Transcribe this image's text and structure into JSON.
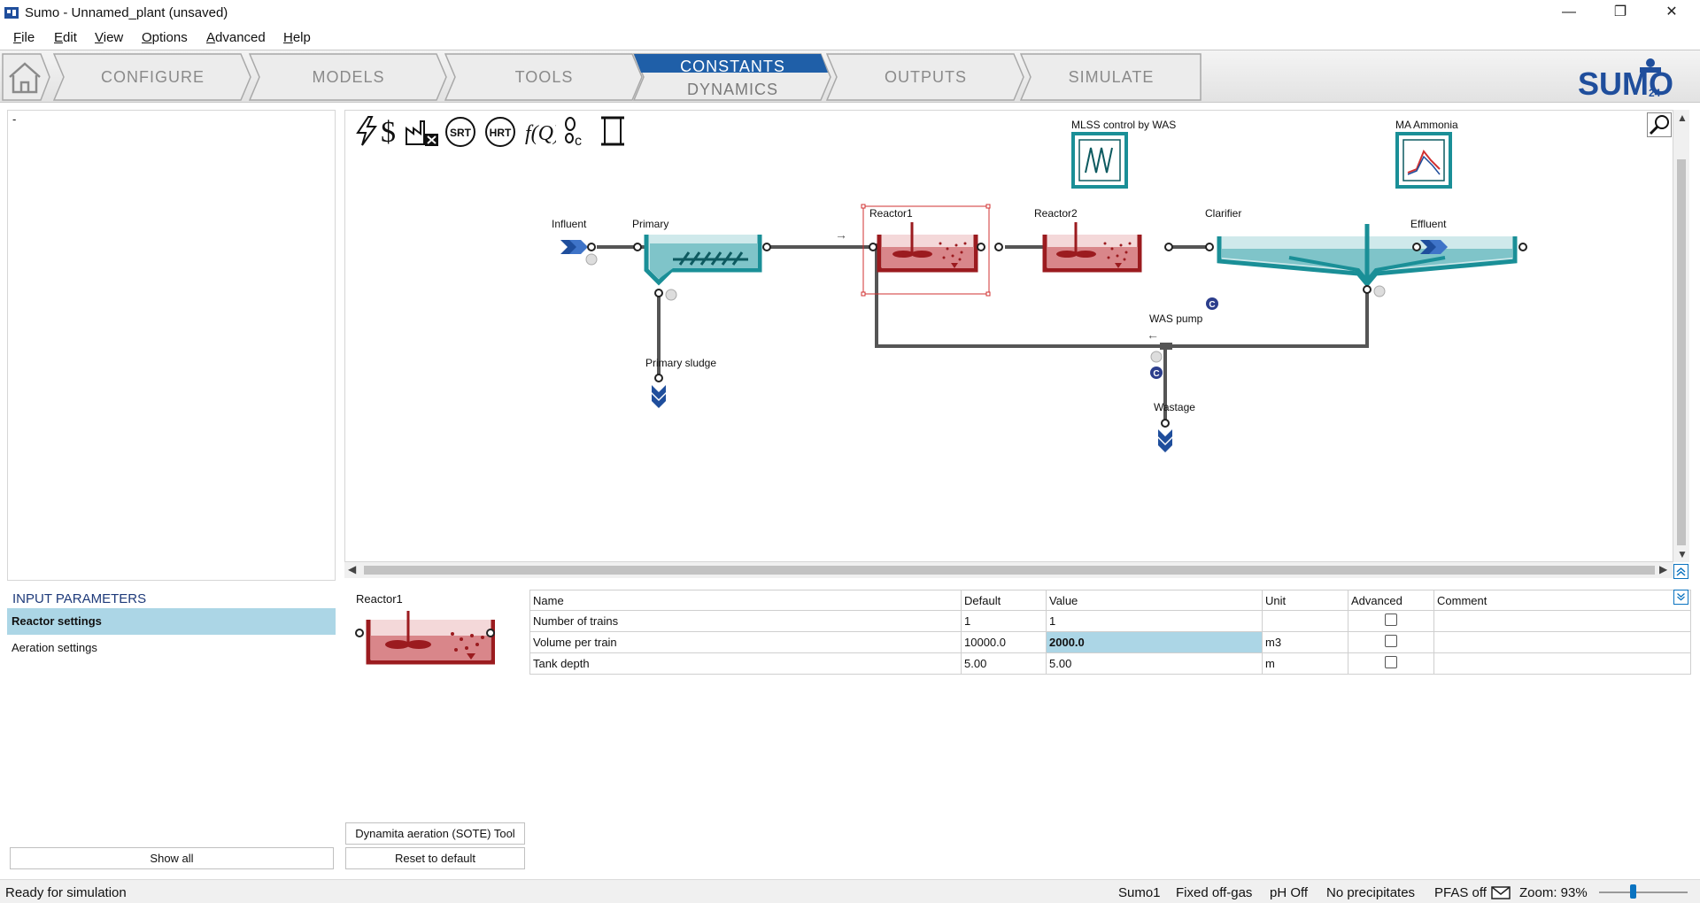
{
  "window": {
    "title": "Sumo - Unnamed_plant (unsaved)",
    "minimize_glyph": "—",
    "maximize_glyph": "❐",
    "close_glyph": "✕"
  },
  "menu": [
    {
      "accel": "F",
      "rest": "ile"
    },
    {
      "accel": "E",
      "rest": "dit"
    },
    {
      "accel": "V",
      "rest": "iew"
    },
    {
      "accel": "O",
      "rest": "ptions"
    },
    {
      "accel": "A",
      "rest": "dvanced"
    },
    {
      "accel": "H",
      "rest": "elp"
    }
  ],
  "tabs": {
    "configure": "CONFIGURE",
    "models": "MODELS",
    "tools": "TOOLS",
    "constants": "CONSTANTS",
    "dynamics": "DYNAMICS",
    "outputs": "OUTPUTS",
    "simulate": "SIMULATE",
    "active": "CONSTANTS"
  },
  "logo": {
    "text": "SUMO",
    "version": "24"
  },
  "left_panel": {
    "text": "-"
  },
  "toolbar_icons": [
    "lightning-icon",
    "dollar-icon",
    "plant-exclude-icon",
    "srt-icon",
    "hrt-icon",
    "function-icon",
    "footprint-carbon-icon",
    "scroll-icon"
  ],
  "toolbar_text": {
    "srt": "SRT",
    "hrt": "HRT",
    "fq": "f(Q)"
  },
  "controllers": {
    "mlss": "MLSS control by WAS",
    "ammonia": "MA Ammonia"
  },
  "flowsheet": {
    "influent": "Influent",
    "primary": "Primary",
    "primary_sludge": "Primary sludge",
    "reactor1": "Reactor1",
    "reactor2": "Reactor2",
    "clarifier": "Clarifier",
    "effluent": "Effluent",
    "was_pump": "WAS pump",
    "wastage": "Wastage",
    "controller_badge": "C"
  },
  "input_parameters": {
    "title": "INPUT PARAMETERS",
    "items": [
      "Reactor settings",
      "Aeration settings"
    ],
    "active": "Reactor settings",
    "show_all": "Show all"
  },
  "selected_unit": "Reactor1",
  "param_table": {
    "columns": [
      "Name",
      "Default",
      "Value",
      "Unit",
      "Advanced",
      "Comment"
    ],
    "rows": [
      {
        "name": "Number of trains",
        "default": "1",
        "value": "1",
        "unit": "",
        "advanced": false,
        "comment": ""
      },
      {
        "name": "Volume per train",
        "default": "10000.0",
        "value": "2000.0",
        "unit": "m3",
        "advanced": false,
        "comment": ""
      },
      {
        "name": "Tank depth",
        "default": "5.00",
        "value": "5.00",
        "unit": "m",
        "advanced": false,
        "comment": ""
      }
    ]
  },
  "buttons": {
    "sote": "Dynamita aeration (SOTE) Tool",
    "reset": "Reset to default"
  },
  "status": {
    "message": "Ready for simulation",
    "model": "Sumo1",
    "offgas": "Fixed off-gas",
    "ph": "pH Off",
    "precip": "No precipitates",
    "pfas": "PFAS off",
    "zoom": "Zoom: 93%",
    "zoom_fraction": 0.38
  },
  "colors": {
    "tab_active": "#1f5fa8",
    "teal": "#1a8f97",
    "reactor": "#9b1b1f",
    "badge": "#2c3e8c",
    "selection": "#d23030",
    "highlight": "#acd6e6"
  }
}
